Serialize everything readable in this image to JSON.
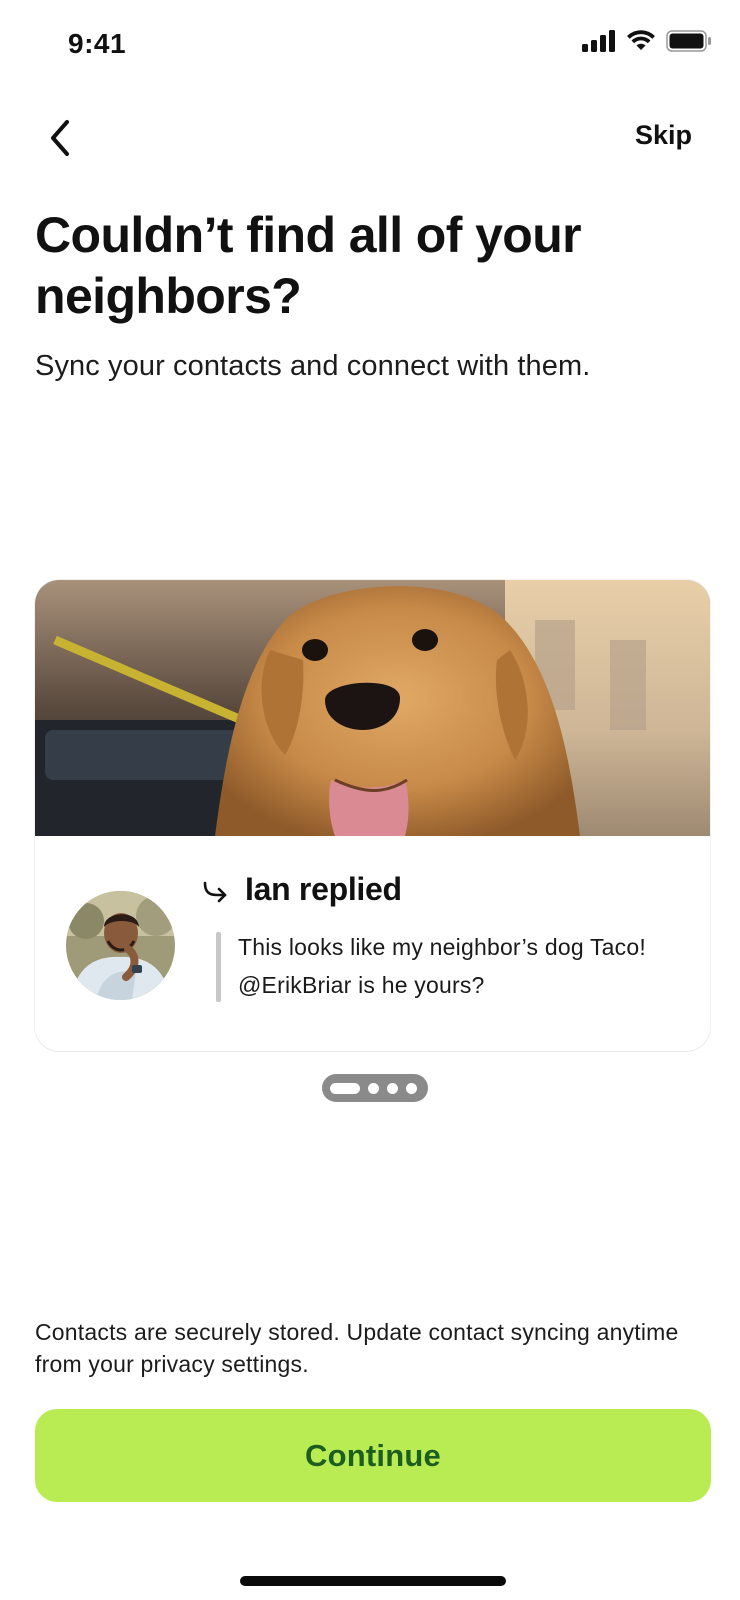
{
  "status_bar": {
    "time": "9:41"
  },
  "nav": {
    "skip_label": "Skip"
  },
  "heading": {
    "title": "Couldn’t find all of your neighbors?",
    "subtitle": "Sync your contacts and connect with them."
  },
  "card": {
    "reply_name": "Ian replied",
    "reply_text": "This looks like my neighbor’s dog Taco! @ErikBriar is he yours?"
  },
  "carousel": {
    "page_count": 4,
    "active_page": 1
  },
  "footer": {
    "privacy_note": "Contacts are securely stored. Update contact syncing anytime from your privacy settings.",
    "continue_label": "Continue"
  },
  "colors": {
    "button_bg": "#b9ec52",
    "button_text": "#1b5e20",
    "indicator": "#8a8a8a"
  }
}
